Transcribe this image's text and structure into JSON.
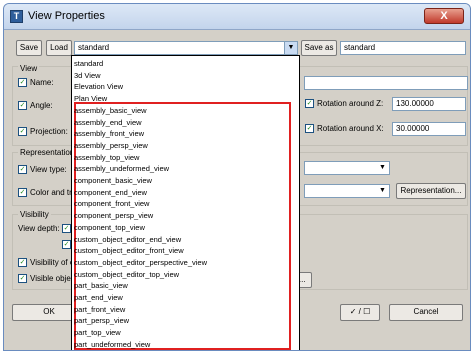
{
  "window": {
    "title": "View Properties",
    "close_glyph": "X"
  },
  "toolbar": {
    "save_label": "Save",
    "load_label": "Load",
    "standard_value": "standard",
    "save_as_label": "Save as",
    "save_as_value": "standard"
  },
  "view_group": {
    "title": "View",
    "name_label": "Name:",
    "angle_label": "Angle:",
    "projection_label": "Projection:",
    "rotation_z_label": "Rotation around Z:",
    "rotation_z_value": "130.00000",
    "rotation_x_label": "Rotation around X:",
    "rotation_x_value": "30.00000"
  },
  "representation_group": {
    "title": "Representation",
    "view_type_label": "View type:",
    "color_label": "Color and tra",
    "representation_button": "Representation..."
  },
  "visibility_group": {
    "title": "Visibility",
    "view_depth_label": "View depth:",
    "visibility_of_label": "Visibility of o",
    "visible_objects_label": "Visible objec",
    "partial_button": "p..."
  },
  "bottom": {
    "ok_label": "OK",
    "cancel_label": "Cancel",
    "toggle_label": "✓ / ☐"
  },
  "dropdown_items": [
    "standard",
    "3d View",
    "Elevation View",
    "Plan View",
    "assembly_basic_view",
    "assembly_end_view",
    "assembly_front_view",
    "assembly_persp_view",
    "assembly_top_view",
    "assembly_undeformed_view",
    "component_basic_view",
    "component_end_view",
    "component_front_view",
    "component_persp_view",
    "component_top_view",
    "custom_object_editor_end_view",
    "custom_object_editor_front_view",
    "custom_object_editor_perspective_view",
    "custom_object_editor_top_view",
    "part_basic_view",
    "part_end_view",
    "part_front_view",
    "part_persp_view",
    "part_top_view",
    "part_undeformed_view"
  ],
  "colors": {
    "highlight_box": "#e02020",
    "title_bar": "#c3d4ec"
  }
}
